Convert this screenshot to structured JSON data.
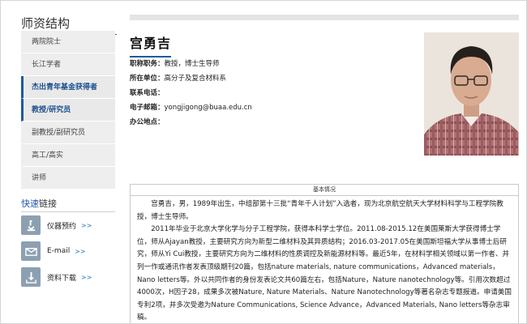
{
  "sidebar": {
    "title_prefix": "师资",
    "title_suffix": "结构",
    "items": [
      {
        "label": "两院院士",
        "active": false
      },
      {
        "label": "长江学者",
        "active": false
      },
      {
        "label": "杰出青年基金获得者",
        "active": true
      },
      {
        "label": "教授/研究员",
        "active": true
      },
      {
        "label": "副教授/副研究员",
        "active": false
      },
      {
        "label": "高工/高实",
        "active": false
      },
      {
        "label": "讲师",
        "active": false
      }
    ],
    "quick_title_prefix": "快速",
    "quick_title_suffix": "链接",
    "quick_links": [
      {
        "label": "仪器预约",
        "arrow": ">>",
        "icon": "microscope-icon"
      },
      {
        "label": "E-mail",
        "arrow": ">>",
        "icon": "envelope-icon"
      },
      {
        "label": "资料下载",
        "arrow": ">>",
        "icon": "download-icon"
      }
    ]
  },
  "profile": {
    "name": "宫勇吉",
    "fields": [
      {
        "key": "职称职务：",
        "value": "教授，博士生导师"
      },
      {
        "key": "所在单位：",
        "value": "高分子及复合材料系"
      },
      {
        "key": "联系电话：",
        "value": ""
      },
      {
        "key": "电子邮箱：",
        "value": "yongjigong@buaa.edu.cn"
      },
      {
        "key": "办公地点：",
        "value": ""
      }
    ]
  },
  "basic": {
    "heading": "基本情况",
    "para1": "宫勇吉，男，1989年出生，中组部第十三批“青年千人计划”入选者，现为北京航空航天大学材料科学与工程学院教授，博士生导师。",
    "para2": "2011年毕业于北京大学化学与分子工程学院，获得本科学士学位。2011.08-2015.12在美国莱斯大学获得博士学位，师从Ajayan教授，主要研究方向为新型二维材料及其异质结构；2016.03-2017.05在美国斯坦福大学从事博士后研究，师从Yi Cui教授，主要研究方向为二维材料的性质调控及新能源材料等。最近5年，在材料学相关领域以第一作者、并列一作或通讯作者发表顶级期刊20篇，包括nature materials, nature communications，Advanced materials，Nano letters等。外以共同作者的身份发表论文共60篇左右，包括Nature，Nature nanotechnology等。引用次数超过4000次，H因子28，成果多次被Nature, Nature Materials、Nature Nanotechnology等著名杂志专题报道。申请美国专利2项，并多次受邀为Nature Communications, Science Advance，Advanced Materials, Nano letters等杂志审稿。"
  },
  "colors": {
    "accent": "#1e5aa0",
    "menu_bg": "#eeeeee",
    "icon_bg": "#8da0b2"
  }
}
